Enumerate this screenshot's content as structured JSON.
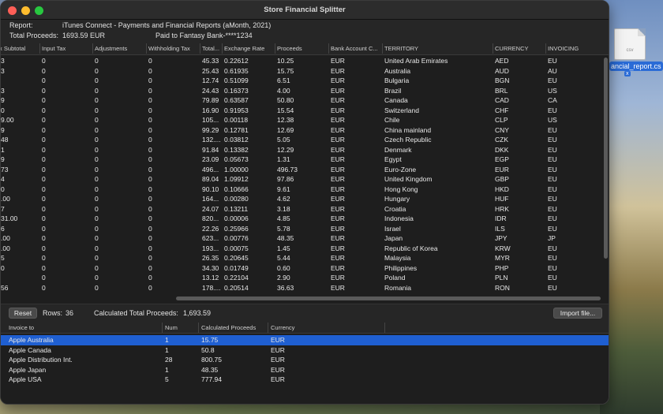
{
  "window": {
    "title": "Store Financial Splitter"
  },
  "info": {
    "report_label": "Report:",
    "report_value": "iTunes Connect - Payments and Financial Reports  (aMonth, 2021)",
    "total_label": "Total Proceeds:",
    "total_value": "1693.59 EUR",
    "paid_to": "Paid to Fantasy Bank-****1234"
  },
  "top_table": {
    "columns": [
      "x Subtotal",
      "Input Tax",
      "Adjustments",
      "Withholding Tax",
      "Total...",
      "Exchange Rate",
      "Proceeds",
      "Bank Account C...",
      "TERRITORY",
      "CURRENCY",
      "INVOICING"
    ],
    "rows": [
      [
        "3",
        "0",
        "0",
        "0",
        "45.33",
        "0.22612",
        "10.25",
        "EUR",
        "United Arab Emirates",
        "AED",
        "EU"
      ],
      [
        "3",
        "0",
        "0",
        "0",
        "25.43",
        "0.61935",
        "15.75",
        "EUR",
        "Australia",
        "AUD",
        "AU"
      ],
      [
        "",
        "0",
        "0",
        "0",
        "12.74",
        "0.51099",
        "6.51",
        "EUR",
        "Bulgaria",
        "BGN",
        "EU"
      ],
      [
        "3",
        "0",
        "0",
        "0",
        "24.43",
        "0.16373",
        "4.00",
        "EUR",
        "Brazil",
        "BRL",
        "US"
      ],
      [
        "9",
        "0",
        "0",
        "0",
        "79.89",
        "0.63587",
        "50.80",
        "EUR",
        "Canada",
        "CAD",
        "CA"
      ],
      [
        "0",
        "0",
        "0",
        "0",
        "16.90",
        "0.91953",
        "15.54",
        "EUR",
        "Switzerland",
        "CHF",
        "EU"
      ],
      [
        "9.00",
        "0",
        "0",
        "0",
        "105...",
        "0.00118",
        "12.38",
        "EUR",
        "Chile",
        "CLP",
        "US"
      ],
      [
        "9",
        "0",
        "0",
        "0",
        "99.29",
        "0.12781",
        "12.69",
        "EUR",
        "China mainland",
        "CNY",
        "EU"
      ],
      [
        "48",
        "0",
        "0",
        "0",
        "132....",
        "0.03812",
        "5.05",
        "EUR",
        "Czech Republic",
        "CZK",
        "EU"
      ],
      [
        "1",
        "0",
        "0",
        "0",
        "91.84",
        "0.13382",
        "12.29",
        "EUR",
        "Denmark",
        "DKK",
        "EU"
      ],
      [
        "9",
        "0",
        "0",
        "0",
        "23.09",
        "0.05673",
        "1.31",
        "EUR",
        "Egypt",
        "EGP",
        "EU"
      ],
      [
        "73",
        "0",
        "0",
        "0",
        "496...",
        "1.00000",
        "496.73",
        "EUR",
        "Euro-Zone",
        "EUR",
        "EU"
      ],
      [
        "4",
        "0",
        "0",
        "0",
        "89.04",
        "1.09912",
        "97.86",
        "EUR",
        "United Kingdom",
        "GBP",
        "EU"
      ],
      [
        "0",
        "0",
        "0",
        "0",
        "90.10",
        "0.10666",
        "9.61",
        "EUR",
        "Hong Kong",
        "HKD",
        "EU"
      ],
      [
        ".00",
        "0",
        "0",
        "0",
        "164...",
        "0.00280",
        "4.62",
        "EUR",
        "Hungary",
        "HUF",
        "EU"
      ],
      [
        "7",
        "0",
        "0",
        "0",
        "24.07",
        "0.13211",
        "3.18",
        "EUR",
        "Croatia",
        "HRK",
        "EU"
      ],
      [
        "31.00",
        "0",
        "0",
        "0",
        "820...",
        "0.00006",
        "4.85",
        "EUR",
        "Indonesia",
        "IDR",
        "EU"
      ],
      [
        "6",
        "0",
        "0",
        "0",
        "22.26",
        "0.25966",
        "5.78",
        "EUR",
        "Israel",
        "ILS",
        "EU"
      ],
      [
        ".00",
        "0",
        "0",
        "0",
        "623...",
        "0.00776",
        "48.35",
        "EUR",
        "Japan",
        "JPY",
        "JP"
      ],
      [
        ".00",
        "0",
        "0",
        "0",
        "193...",
        "0.00075",
        "1.45",
        "EUR",
        "Republic of Korea",
        "KRW",
        "EU"
      ],
      [
        "5",
        "0",
        "0",
        "0",
        "26.35",
        "0.20645",
        "5.44",
        "EUR",
        "Malaysia",
        "MYR",
        "EU"
      ],
      [
        "0",
        "0",
        "0",
        "0",
        "34.30",
        "0.01749",
        "0.60",
        "EUR",
        "Philippines",
        "PHP",
        "EU"
      ],
      [
        "",
        "0",
        "0",
        "0",
        "13.12",
        "0.22104",
        "2.90",
        "EUR",
        "Poland",
        "PLN",
        "EU"
      ],
      [
        "56",
        "0",
        "0",
        "0",
        "178....",
        "0.20514",
        "36.63",
        "EUR",
        "Romania",
        "RON",
        "EU"
      ]
    ]
  },
  "toolbar": {
    "reset_label": "Reset",
    "rows_label": "Rows:",
    "rows_value": "36",
    "calc_label": "Calculated Total Proceeds:",
    "calc_value": "1,693.59",
    "import_label": "Import file..."
  },
  "bottom_table": {
    "columns": [
      "Invoice to",
      "Num",
      "Calculated Proceeds",
      "Currency"
    ],
    "rows": [
      [
        "Apple Australia",
        "1",
        "15.75",
        "EUR"
      ],
      [
        "Apple Canada",
        "1",
        "50.8",
        "EUR"
      ],
      [
        "Apple Distribution Int.",
        "28",
        "800.75",
        "EUR"
      ],
      [
        "Apple Japan",
        "1",
        "48.35",
        "EUR"
      ],
      [
        "Apple USA",
        "5",
        "777.94",
        "EUR"
      ]
    ],
    "selected_row": 0
  },
  "desktop": {
    "file_label": "ancial_report.cs",
    "file_ext": "csv",
    "close_glyph": "x"
  }
}
